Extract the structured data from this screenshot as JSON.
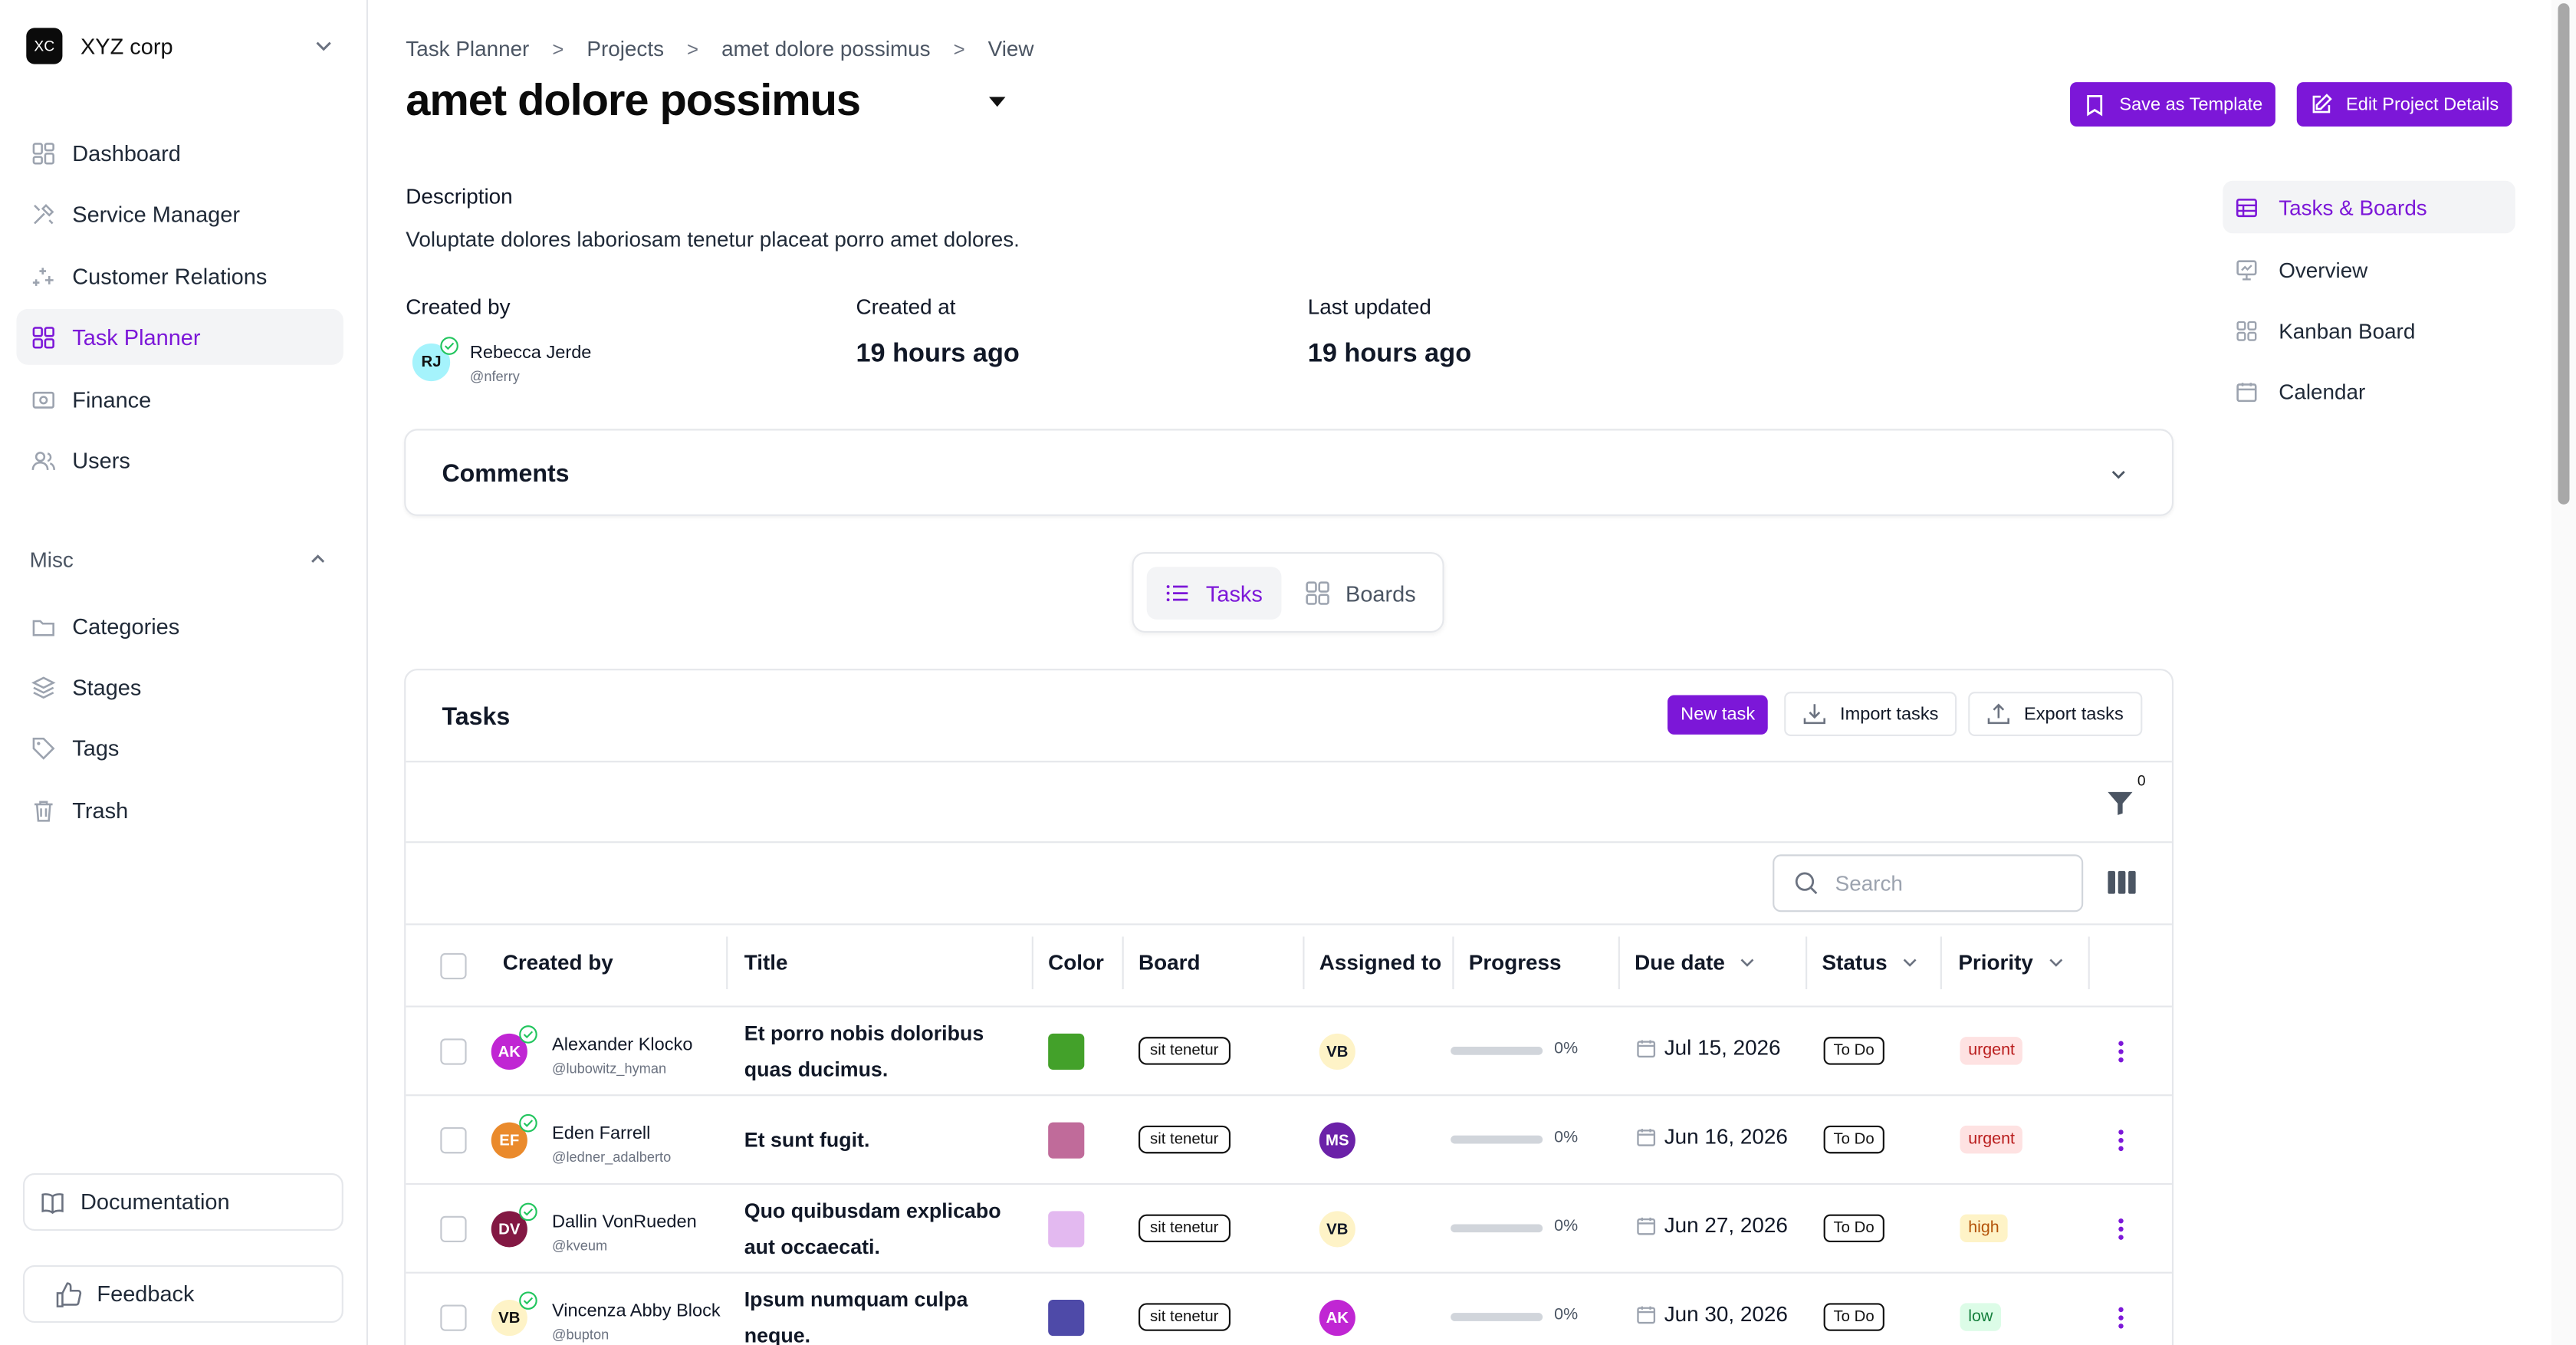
{
  "org": {
    "logo": "XC",
    "name": "XYZ corp"
  },
  "sidebar": {
    "items": [
      {
        "label": "Dashboard",
        "icon": "dashboard-icon"
      },
      {
        "label": "Service Manager",
        "icon": "tools-icon"
      },
      {
        "label": "Customer Relations",
        "icon": "sparkles-icon"
      },
      {
        "label": "Task Planner",
        "icon": "grid-icon",
        "active": true
      },
      {
        "label": "Finance",
        "icon": "money-icon"
      },
      {
        "label": "Users",
        "icon": "users-icon"
      }
    ],
    "misc_label": "Misc",
    "misc_items": [
      {
        "label": "Categories",
        "icon": "folder-icon"
      },
      {
        "label": "Stages",
        "icon": "layers-icon"
      },
      {
        "label": "Tags",
        "icon": "tag-icon"
      },
      {
        "label": "Trash",
        "icon": "trash-icon"
      }
    ],
    "documentation": "Documentation",
    "feedback": "Feedback"
  },
  "breadcrumb": [
    "Task Planner",
    "Projects",
    "amet dolore possimus",
    "View"
  ],
  "page": {
    "title": "amet dolore possimus",
    "save_template": "Save as Template",
    "edit_details": "Edit Project Details",
    "description_label": "Description",
    "description": "Voluptate dolores laboriosam tenetur placeat porro amet dolores.",
    "created_by_label": "Created by",
    "creator": {
      "initials": "RJ",
      "name": "Rebecca Jerde",
      "handle": "@nferry"
    },
    "created_at_label": "Created at",
    "created_at": "19 hours ago",
    "last_updated_label": "Last updated",
    "last_updated": "19 hours ago"
  },
  "comments": {
    "title": "Comments"
  },
  "view_tabs": {
    "tasks": "Tasks",
    "boards": "Boards"
  },
  "tasks": {
    "title": "Tasks",
    "new_task": "New task",
    "import": "Import tasks",
    "export": "Export tasks",
    "filter_count": "0",
    "search_placeholder": "Search",
    "columns": [
      "Created by",
      "Title",
      "Color",
      "Board",
      "Assigned to",
      "Progress",
      "Due date",
      "Status",
      "Priority"
    ],
    "rows": [
      {
        "initials": "AK",
        "avatar_color": "#c026d3",
        "name": "Alexander Klocko",
        "handle": "@lubowitz_hyman",
        "title": "Et porro nobis doloribus quas ducimus.",
        "color": "#43a12a",
        "board": "sit tenetur",
        "assignee": "VB",
        "assignee_bg": "#fef3c7",
        "assignee_fg": "#111827",
        "progress": 0,
        "progress_label": "0%",
        "due": "Jul 15, 2026",
        "status": "To Do",
        "priority": "urgent",
        "priority_bg": "#fee2e2",
        "priority_fg": "#b91c1c"
      },
      {
        "initials": "EF",
        "avatar_color": "#ea8a2c",
        "name": "Eden Farrell",
        "handle": "@ledner_adalberto",
        "title": "Et sunt fugit.",
        "color": "#c06b9a",
        "board": "sit tenetur",
        "assignee": "MS",
        "assignee_bg": "#6b21a8",
        "assignee_fg": "#ffffff",
        "progress": 0,
        "progress_label": "0%",
        "due": "Jun 16, 2026",
        "status": "To Do",
        "priority": "urgent",
        "priority_bg": "#fee2e2",
        "priority_fg": "#b91c1c"
      },
      {
        "initials": "DV",
        "avatar_color": "#831843",
        "name": "Dallin VonRueden",
        "handle": "@kveum",
        "title": "Quo quibusdam explicabo aut occaecati.",
        "color": "#e3b9f0",
        "board": "sit tenetur",
        "assignee": "VB",
        "assignee_bg": "#fef3c7",
        "assignee_fg": "#111827",
        "progress": 0,
        "progress_label": "0%",
        "due": "Jun 27, 2026",
        "status": "To Do",
        "priority": "high",
        "priority_bg": "#fef3c7",
        "priority_fg": "#b45309"
      },
      {
        "initials": "VB",
        "avatar_color": "#fef3c7",
        "name": "Vincenza Abby Block",
        "handle": "@bupton",
        "title": "Ipsum numquam culpa neque.",
        "color": "#4e4aa8",
        "board": "sit tenetur",
        "assignee": "AK",
        "assignee_bg": "#c026d3",
        "assignee_fg": "#ffffff",
        "progress": 0,
        "progress_label": "0%",
        "due": "Jun 30, 2026",
        "status": "To Do",
        "priority": "low",
        "priority_bg": "#dcfce7",
        "priority_fg": "#15803d"
      }
    ]
  },
  "right_nav": [
    {
      "label": "Tasks & Boards",
      "icon": "table-icon",
      "active": true
    },
    {
      "label": "Overview",
      "icon": "presentation-icon"
    },
    {
      "label": "Kanban Board",
      "icon": "kanban-icon"
    },
    {
      "label": "Calendar",
      "icon": "calendar-icon"
    }
  ],
  "colors": {
    "accent": "#7c17d8",
    "border": "#e5e7eb"
  }
}
